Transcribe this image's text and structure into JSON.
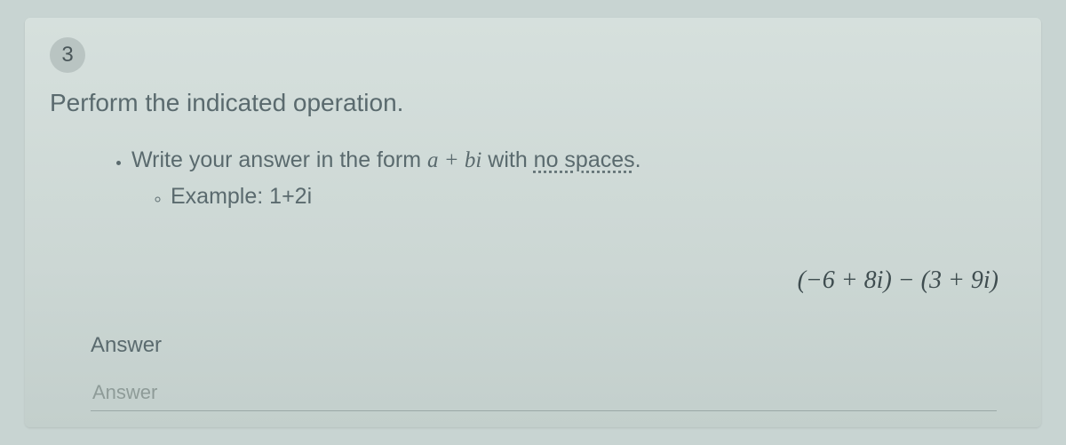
{
  "question": {
    "number": "3",
    "prompt": "Perform the indicated operation.",
    "bullet_main_pre": "Write your answer in the form ",
    "bullet_main_form": "a + bi",
    "bullet_main_mid": " with ",
    "bullet_main_nospaces": "no spaces",
    "bullet_main_post": ".",
    "example_label": "Example: ",
    "example_value": "1+2i",
    "expression": "(−6 + 8i) − (3 + 9i)"
  },
  "answer": {
    "label": "Answer",
    "placeholder": "Answer",
    "value": ""
  }
}
